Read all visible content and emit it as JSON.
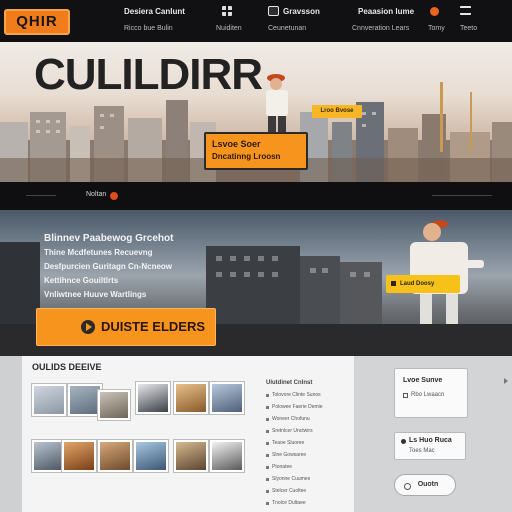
{
  "brand": {
    "logo_text": "QHIR",
    "accent": "#f7941d",
    "dark": "#111113"
  },
  "topnav": {
    "links": [
      {
        "label": "Desiera Canlunt",
        "sub": "Ricco bue Bulin",
        "icon": "none"
      },
      {
        "label": "",
        "sub": "Nuiditen",
        "icon": "grid-icon"
      },
      {
        "label": "Gravsson",
        "sub": "Ceunetunan",
        "icon": "square-icon"
      },
      {
        "label": "Peaasion lume",
        "sub": "Cnnveration Lears",
        "icon": "none"
      },
      {
        "label": "",
        "sub": "Tomy",
        "icon": "orange-dot-icon"
      },
      {
        "label": "",
        "sub": "Teeto",
        "icon": "menu-icon"
      }
    ]
  },
  "hero": {
    "title": "CULILDIRR",
    "cta_line1": "Lsvoe Soer",
    "cta_line2": "Dncatinng Lroosn",
    "tag": "Lroo Bvose"
  },
  "strip": {
    "text": "Noltan"
  },
  "banner": {
    "lines": [
      "Blinnev Paabewog Grcehot",
      "Thine Mcdfetunes Recuevng",
      "Desfpurcien Guritagn Cn-Ncneow",
      "Kettihnce Gouiltlrts",
      "Vnliwtnee Huuve Wartlings"
    ],
    "cta": "DUISTE ELDERS",
    "tag": "Laud Doosy"
  },
  "gallery": {
    "title": "OULIDS DEEIVE",
    "list_head": "Ulutdinet Cnlnst",
    "list_items": [
      "Tolovore Clinte Sunos",
      "Polowee Faerie Demie",
      "Woneer Chofunu",
      "Sretnlcer Unctwirs",
      "Teaoe Sluoree",
      "Slne Gowsaree",
      "Ptonatee",
      "Slyonne Cuumee",
      "Stelcer Cuoltee",
      "Tnolce Dultaee"
    ]
  },
  "side": {
    "card1_title": "Lvoe Sunve",
    "card1_sub": "Rbo Lwaacn",
    "card2_title": "Ls Huo Ruca",
    "card2_sub": "Toes Mac",
    "button": "Ouotn"
  }
}
